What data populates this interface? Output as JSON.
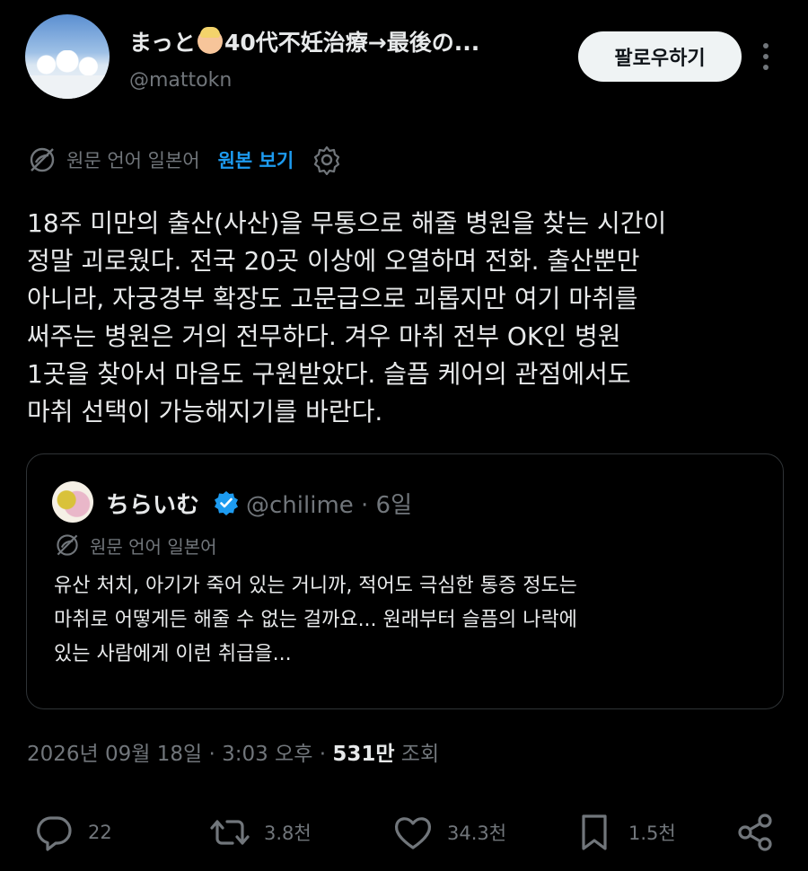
{
  "author": {
    "display_name_pre": "まっと",
    "display_name_post": "40代不妊治療→最後の...",
    "handle": "@mattokn"
  },
  "follow_label": "팔로우하기",
  "translation": {
    "label": "원문 언어 일본어",
    "show_original": "원본 보기"
  },
  "tweet_lines": [
    "18주 미만의 출산(사산)을 무통으로 해줄 병원을 찾는 시간이",
    "정말 괴로웠다. 전국 20곳 이상에 오열하며 전화. 출산뿐만",
    "아니라, 자궁경부 확장도 고문급으로 괴롭지만 여기 마취를",
    "써주는 병원은 거의 전무하다. 겨우 마취 전부 OK인 병원",
    "1곳을 찾아서 마음도 구원받았다. 슬픔 케어의 관점에서도",
    "마취 선택이 가능해지기를 바란다."
  ],
  "quote": {
    "name": "ちらいむ",
    "handle_time": "@chilime · 6일",
    "translation_label": "원문 언어 일본어",
    "lines": [
      "유산 처치, 아기가 죽어 있는 거니까, 적어도 극심한 통증 정도는",
      "마취로 어떻게든 해줄 수 없는 걸까요... 원래부터 슬픔의 나락에",
      "있는 사람에게 이런 취급을..."
    ]
  },
  "meta": {
    "datetime": "2026년 09월 18일 · 3:03 오후 · ",
    "views_count": "531만",
    "views_label": " 조회"
  },
  "actions": {
    "replies": "22",
    "reposts": "3.8천",
    "likes": "34.3천",
    "bookmarks": "1.5천"
  },
  "icons": [
    "reply-icon",
    "repost-icon",
    "like-icon",
    "bookmark-icon",
    "share-icon",
    "translate-icon",
    "gear-icon",
    "verified-icon",
    "more-icon"
  ],
  "colors": {
    "accent": "#1d9bf0",
    "muted": "#71767b",
    "text": "#e7e9ea",
    "background": "#000000"
  }
}
